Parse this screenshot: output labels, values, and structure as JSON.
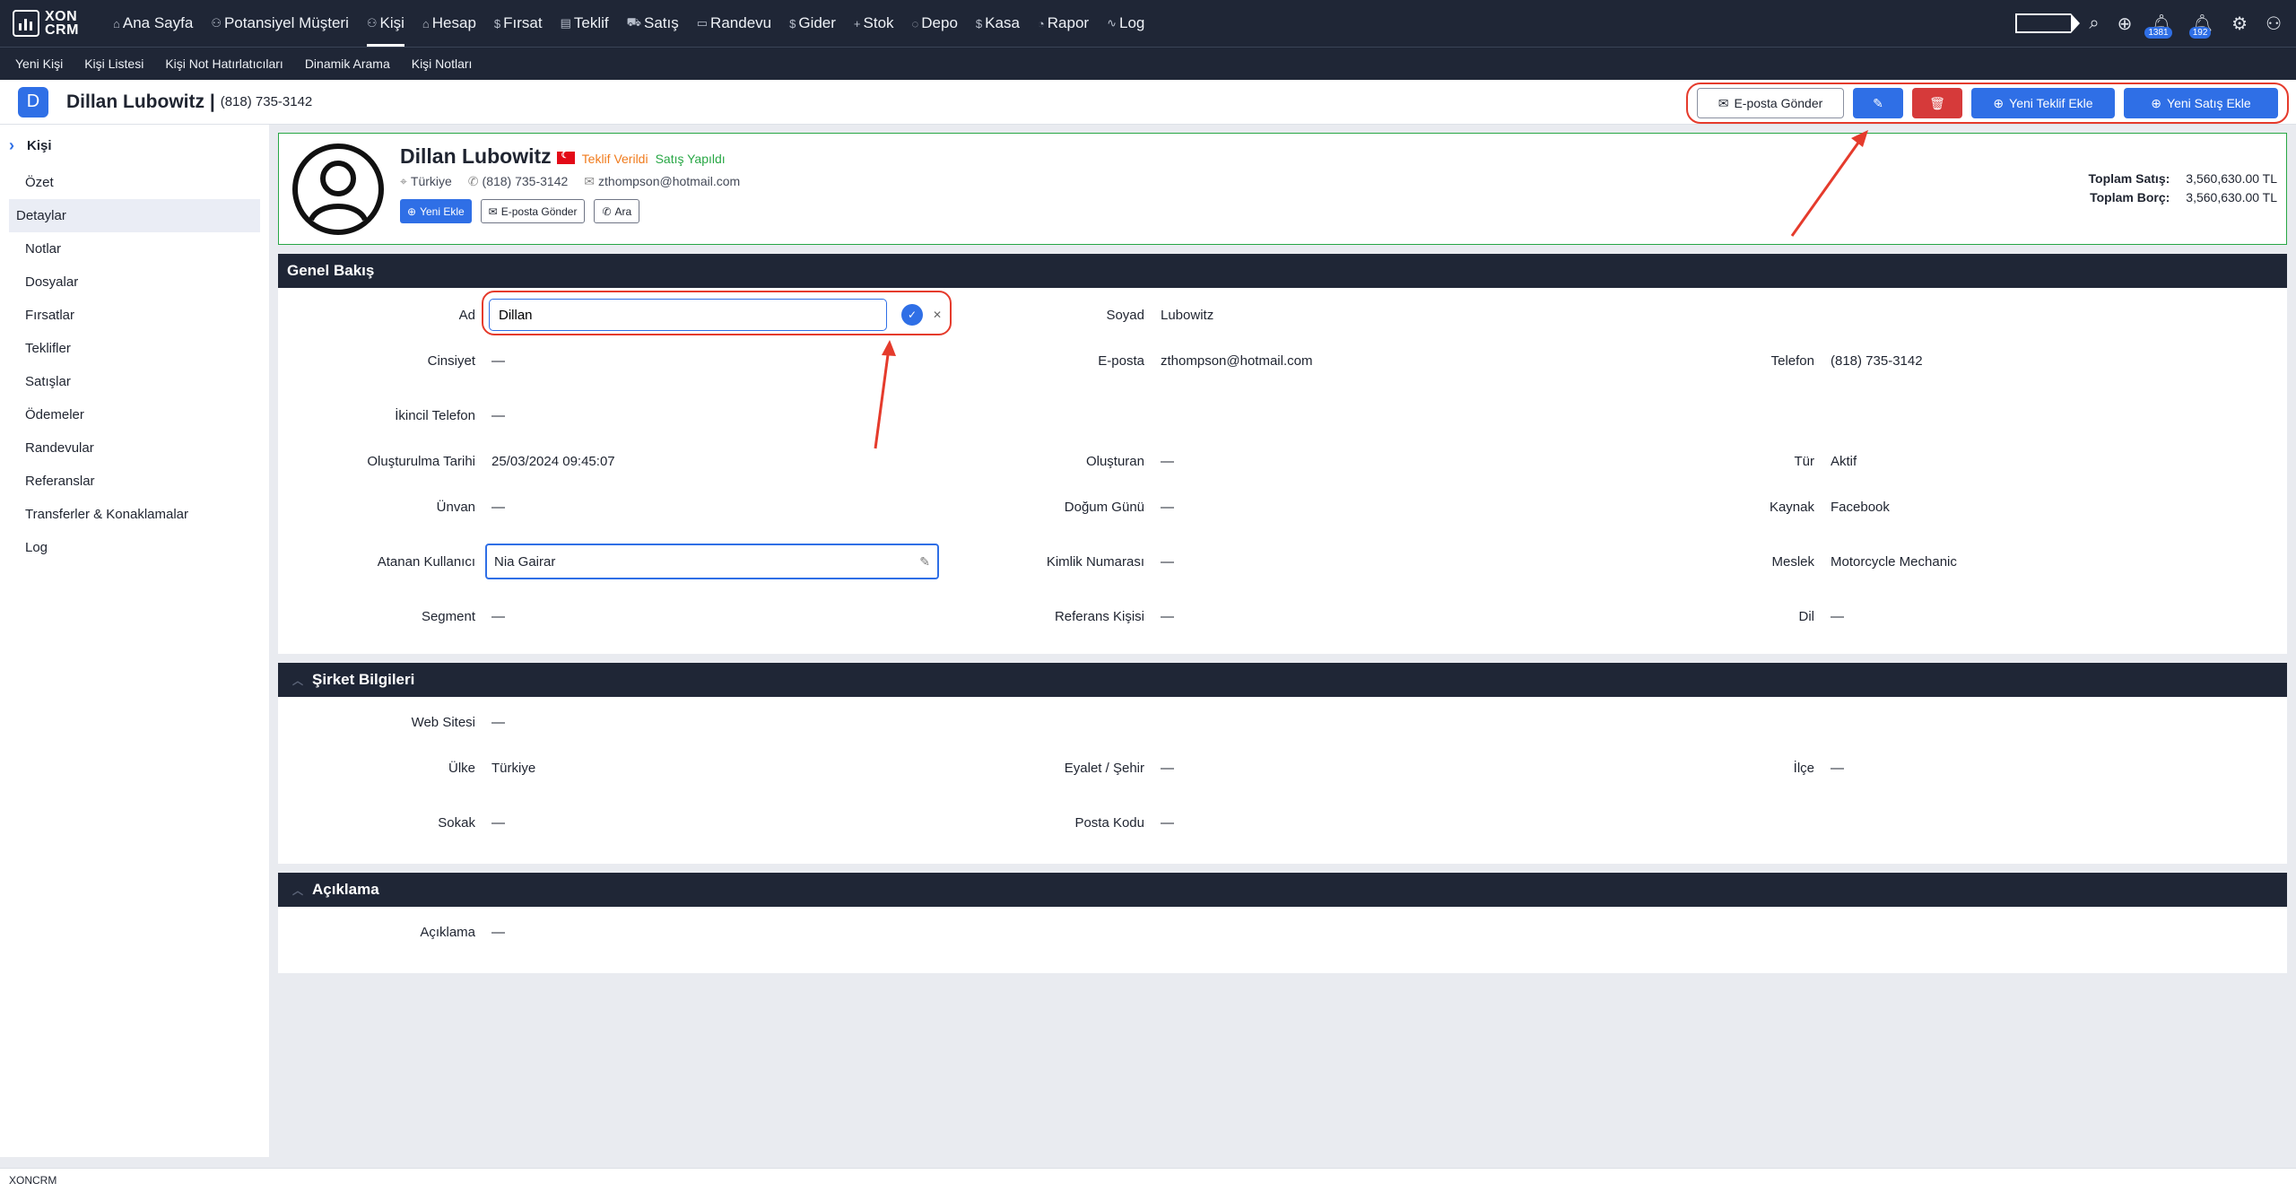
{
  "app": {
    "logo_line1": "XON",
    "logo_line2": "CRM"
  },
  "nav": {
    "items": [
      {
        "label": "Ana Sayfa",
        "icon": "⌂"
      },
      {
        "label": "Potansiyel Müşteri",
        "icon": "⚇"
      },
      {
        "label": "Kişi",
        "icon": "⚇"
      },
      {
        "label": "Hesap",
        "icon": "⌂"
      },
      {
        "label": "Fırsat",
        "icon": "$"
      },
      {
        "label": "Teklif",
        "icon": "▤"
      },
      {
        "label": "Satış",
        "icon": "⛟"
      },
      {
        "label": "Randevu",
        "icon": "▭"
      },
      {
        "label": "Gider",
        "icon": "$"
      },
      {
        "label": "Stok",
        "icon": "+"
      },
      {
        "label": "Depo",
        "icon": "◌"
      },
      {
        "label": "Kasa",
        "icon": "$"
      },
      {
        "label": "Rapor",
        "icon": "◔"
      },
      {
        "label": "Log",
        "icon": "∿"
      }
    ],
    "badge1": "1381",
    "badge2": "192"
  },
  "subnav": [
    "Yeni Kişi",
    "Kişi Listesi",
    "Kişi Not Hatırlatıcıları",
    "Dinamik Arama",
    "Kişi Notları"
  ],
  "header": {
    "avatar_letter": "D",
    "name": "Dillan Lubowitz |",
    "phone": "(818) 735-3142",
    "btn_email": "E-posta Gönder",
    "btn_quote": "Yeni Teklif Ekle",
    "btn_sale": "Yeni Satış Ekle"
  },
  "sidebar": {
    "title": "Kişi",
    "items": [
      "Özet",
      "Detaylar",
      "Notlar",
      "Dosyalar",
      "Fırsatlar",
      "Teklifler",
      "Satışlar",
      "Ödemeler",
      "Randevular",
      "Referanslar",
      "Transferler & Konaklamalar",
      "Log"
    ]
  },
  "profile": {
    "name": "Dillan Lubowitz",
    "tag1": "Teklif Verildi",
    "tag2": "Satış Yapıldı",
    "country": "Türkiye",
    "phone": "(818) 735-3142",
    "email": "zthompson@hotmail.com",
    "btn_new": "Yeni Ekle",
    "btn_email": "E-posta Gönder",
    "btn_call": "Ara",
    "total_sales_label": "Toplam Satış:",
    "total_sales": "3,560,630.00 TL",
    "total_debt_label": "Toplam Borç:",
    "total_debt": "3,560,630.00 TL"
  },
  "overview": {
    "title": "Genel Bakış",
    "ad_label": "Ad",
    "ad_value": "Dillan",
    "soyad_label": "Soyad",
    "soyad_value": "Lubowitz",
    "cinsiyet_label": "Cinsiyet",
    "cinsiyet_value": "—",
    "eposta_label": "E-posta",
    "eposta_value": "zthompson@hotmail.com",
    "telefon_label": "Telefon",
    "telefon_value": "(818) 735-3142",
    "ikincil_label": "İkincil Telefon",
    "ikincil_value": "—",
    "olusturulma_label": "Oluşturulma Tarihi",
    "olusturulma_value": "25/03/2024 09:45:07",
    "olusturan_label": "Oluşturan",
    "olusturan_value": "—",
    "tur_label": "Tür",
    "tur_value": "Aktif",
    "unvan_label": "Ünvan",
    "unvan_value": "—",
    "dogum_label": "Doğum Günü",
    "dogum_value": "—",
    "kaynak_label": "Kaynak",
    "kaynak_value": "Facebook",
    "atanan_label": "Atanan Kullanıcı",
    "atanan_value": "Nia Gairar",
    "kimlik_label": "Kimlik Numarası",
    "kimlik_value": "—",
    "meslek_label": "Meslek",
    "meslek_value": "Motorcycle Mechanic",
    "segment_label": "Segment",
    "segment_value": "—",
    "referans_label": "Referans Kişisi",
    "referans_value": "—",
    "dil_label": "Dil",
    "dil_value": "—"
  },
  "company": {
    "title": "Şirket Bilgileri",
    "web_label": "Web Sitesi",
    "web_value": "—",
    "ulke_label": "Ülke",
    "ulke_value": "Türkiye",
    "eyalet_label": "Eyalet / Şehir",
    "eyalet_value": "—",
    "ilce_label": "İlçe",
    "ilce_value": "—",
    "sokak_label": "Sokak",
    "sokak_value": "—",
    "posta_label": "Posta Kodu",
    "posta_value": "—"
  },
  "description": {
    "title": "Açıklama",
    "label": "Açıklama",
    "value": "—"
  },
  "statusbar": "XONCRM",
  "colors": {
    "nav_bg": "#1f2636",
    "accent": "#2f6fe6",
    "danger": "#d63a3a",
    "annotation": "#e53b2c",
    "success": "#28a745"
  }
}
